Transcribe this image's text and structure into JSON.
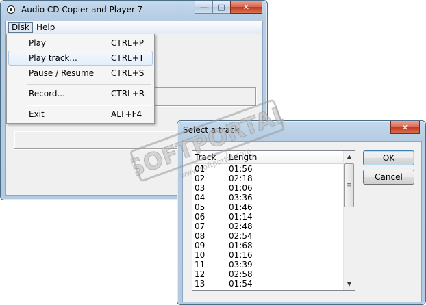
{
  "main_window": {
    "title": "Audio CD Copier and Player-7",
    "minimize_glyph": "—",
    "maximize_glyph": "□",
    "close_glyph": "✕"
  },
  "menubar": {
    "disk": "Disk",
    "help": "Help"
  },
  "disk_menu": {
    "items": [
      {
        "label": "Play",
        "shortcut": "CTRL+P"
      },
      {
        "label": "Play track...",
        "shortcut": "CTRL+T"
      },
      {
        "label": "Pause / Resume",
        "shortcut": "CTRL+S"
      },
      {
        "label": "Record...",
        "shortcut": "CTRL+R"
      },
      {
        "label": "Exit",
        "shortcut": "ALT+F4"
      }
    ]
  },
  "dialog": {
    "title": "Select a track",
    "close_glyph": "✕",
    "ok_label": "OK",
    "cancel_label": "Cancel",
    "columns": [
      "Track",
      "Length"
    ],
    "rows": [
      [
        "01",
        "01:56"
      ],
      [
        "02",
        "02:18"
      ],
      [
        "03",
        "01:06"
      ],
      [
        "04",
        "03:36"
      ],
      [
        "05",
        "01:46"
      ],
      [
        "06",
        "01:14"
      ],
      [
        "07",
        "02:48"
      ],
      [
        "08",
        "02:54"
      ],
      [
        "09",
        "01:68"
      ],
      [
        "10",
        "01:16"
      ],
      [
        "11",
        "03:39"
      ],
      [
        "12",
        "02:58"
      ],
      [
        "13",
        "01:54"
      ]
    ]
  },
  "watermark": {
    "brand": "SOFTPORTAL",
    "url": "www.softportal.com"
  }
}
